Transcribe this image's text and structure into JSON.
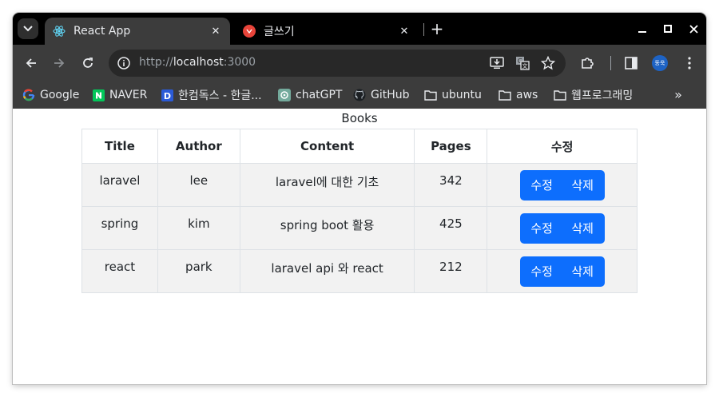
{
  "browser": {
    "tabs": [
      {
        "title": "React App",
        "active": true,
        "icon": "react-icon"
      },
      {
        "title": "글쓰기",
        "active": false,
        "icon": "app-icon"
      }
    ],
    "address": {
      "scheme": "http://",
      "host": "localhost",
      "port": ":3000"
    },
    "profile_label": "동욱",
    "bookmarks": [
      {
        "label": "Google",
        "icon": "google-icon"
      },
      {
        "label": "NAVER",
        "icon": "naver-icon"
      },
      {
        "label": "한컴독스 - 한글...",
        "icon": "hancom-icon"
      },
      {
        "label": "chatGPT",
        "icon": "chatgpt-icon"
      },
      {
        "label": "GitHub",
        "icon": "github-icon"
      },
      {
        "label": "ubuntu",
        "icon": "folder-icon"
      },
      {
        "label": "aws",
        "icon": "folder-icon"
      },
      {
        "label": "웹프로그래밍",
        "icon": "folder-icon"
      }
    ]
  },
  "page": {
    "caption": "Books",
    "columns": [
      "Title",
      "Author",
      "Content",
      "Pages",
      "수정"
    ],
    "rows": [
      {
        "title": "laravel",
        "author": "lee",
        "content": "laravel에 대한 기초",
        "pages": "342"
      },
      {
        "title": "spring",
        "author": "kim",
        "content": "spring boot 활용",
        "pages": "425"
      },
      {
        "title": "react",
        "author": "park",
        "content": "laravel api 와 react",
        "pages": "212"
      }
    ],
    "edit_label": "수정",
    "delete_label": "삭제"
  },
  "colors": {
    "accent": "#0d6efd",
    "chrome_dark": "#3c3c3c",
    "tabstrip": "#000000"
  }
}
